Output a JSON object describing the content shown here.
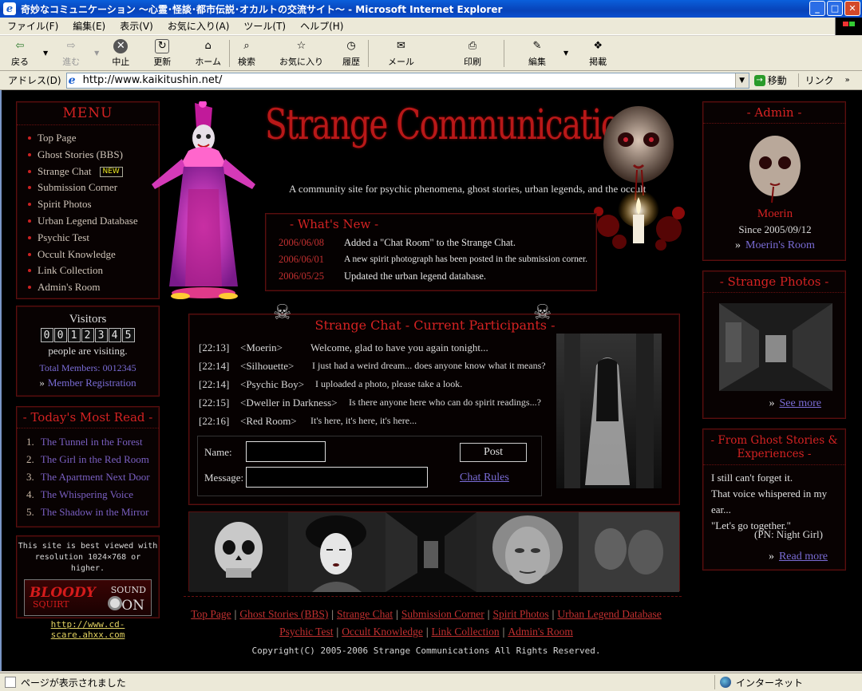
{
  "window": {
    "title": "奇妙なコミュニケーション 〜心霊･怪談･都市伝説･オカルトの交流サイト〜 - Microsoft Internet Explorer",
    "controls": {
      "minimize": "_",
      "maximize": "□",
      "close": "✕"
    }
  },
  "menubar": [
    "ファイル(F)",
    "編集(E)",
    "表示(V)",
    "お気に入り(A)",
    "ツール(T)",
    "ヘルプ(H)"
  ],
  "toolbar": {
    "back": "戻る",
    "forward": "進む",
    "stop": "中止",
    "refresh": "更新",
    "home": "ホーム",
    "search": "検索",
    "favorites": "お気に入り",
    "history": "履歴",
    "mail": "メール",
    "print": "印刷",
    "edit": "編集",
    "discuss": "掲載"
  },
  "address": {
    "label": "アドレス(D)",
    "url": "http://www.kaikitushin.net/",
    "go": "移動",
    "links": "リンク"
  },
  "site": {
    "title": "Strange Communications",
    "subtitle": "A community site for psychic phenomena, ghost stories, urban legends, and the occult",
    "menu": {
      "header": "MENU",
      "items": [
        "Top Page",
        "Ghost Stories (BBS)",
        "Strange Chat",
        "Submission Corner",
        "Spirit Photos",
        "Urban Legend Database",
        "Psychic Test",
        "Occult Knowledge",
        "Link Collection",
        "Admin's Room"
      ],
      "new_tag": "NEW"
    },
    "visitors": {
      "header": "Visitors",
      "digits": [
        "0",
        "0",
        "1",
        "2",
        "3",
        "4",
        "5"
      ],
      "caption": "people are visiting.",
      "total": "Total Members: 0012345",
      "register_prefix": "»",
      "register": "Member Registration"
    },
    "most_read": {
      "header": "- Today's Most Read -",
      "items": [
        {
          "n": "1.",
          "title": "The Tunnel in the Forest"
        },
        {
          "n": "2.",
          "title": "The Girl in the Red Room"
        },
        {
          "n": "3.",
          "title": "The Apartment Next Door"
        },
        {
          "n": "4.",
          "title": "The Whispering Voice"
        },
        {
          "n": "5.",
          "title": "The Shadow in the Mirror"
        }
      ]
    },
    "best_viewed": {
      "line1": "This site is best viewed with",
      "line2": "resolution 1024×768 or higher.",
      "banner_a": "BLOODY",
      "banner_b": "SQUIRT",
      "banner_c": "SOUND",
      "banner_d": "ON",
      "link": "http://www.cd-scare.ahxx.com"
    },
    "whats_new": {
      "header": "- What's New -",
      "items": [
        {
          "date": "2006/06/08",
          "text": "Added a \"Chat Room\" to the Strange Chat."
        },
        {
          "date": "2006/06/01",
          "text": "A new spirit photograph has been posted in the submission corner."
        },
        {
          "date": "2006/05/25",
          "text": "Updated the urban legend database."
        }
      ]
    },
    "chat": {
      "header": "Strange Chat - Current Participants -",
      "lines": [
        {
          "time": "[22:13]",
          "name": "<Moerin>",
          "msg": "Welcome, glad to have you again tonight..."
        },
        {
          "time": "[22:14]",
          "name": "<Silhouette>",
          "msg": "I just had a weird dream... does anyone know what it means?"
        },
        {
          "time": "[22:14]",
          "name": "<Psychic Boy>",
          "msg": "I uploaded a photo, please take a look."
        },
        {
          "time": "[22:15]",
          "name": "<Dweller in Darkness>",
          "msg": "Is there anyone here who can do spirit readings...?"
        },
        {
          "time": "[22:16]",
          "name": "<Red Room>",
          "msg": "It's here, it's here, it's here..."
        }
      ],
      "name_label": "Name:",
      "message_label": "Message:",
      "post_button": "Post",
      "rules_link": "Chat Rules"
    },
    "admin": {
      "header": "- Admin -",
      "name": "Moerin",
      "since": "Since 2005/09/12",
      "room_prefix": "»",
      "room_link": "Moerin's Room"
    },
    "strange_photos": {
      "header": "- Strange Photos -",
      "more_prefix": "»",
      "more": "See more"
    },
    "ghost_stories": {
      "header_line1": "- From Ghost Stories &",
      "header_line2": "Experiences -",
      "quote1": "I still can't forget it.",
      "quote2": "That voice whispered in my ear...",
      "quote3": "\"Let's go together.\"",
      "author": "(PN: Night Girl)",
      "more_prefix": "»",
      "more": "Read more"
    },
    "footer": {
      "row1": [
        "Top Page",
        "Ghost Stories (BBS)",
        "Strange Chat",
        "Submission Corner",
        "Spirit Photos",
        "Urban Legend Database"
      ],
      "row2": [
        "Psychic Test",
        "Occult Knowledge",
        "Link Collection",
        "Admin's Room"
      ],
      "separator": "|",
      "copyright": "Copyright(C) 2005-2006  Strange Communications  All Rights Reserved."
    }
  },
  "status": {
    "text": "ページが表示されました",
    "zone": "インターネット"
  },
  "colors": {
    "accent_red": "#c23030",
    "link_purple": "#7a6cd6",
    "background": "#000000"
  }
}
